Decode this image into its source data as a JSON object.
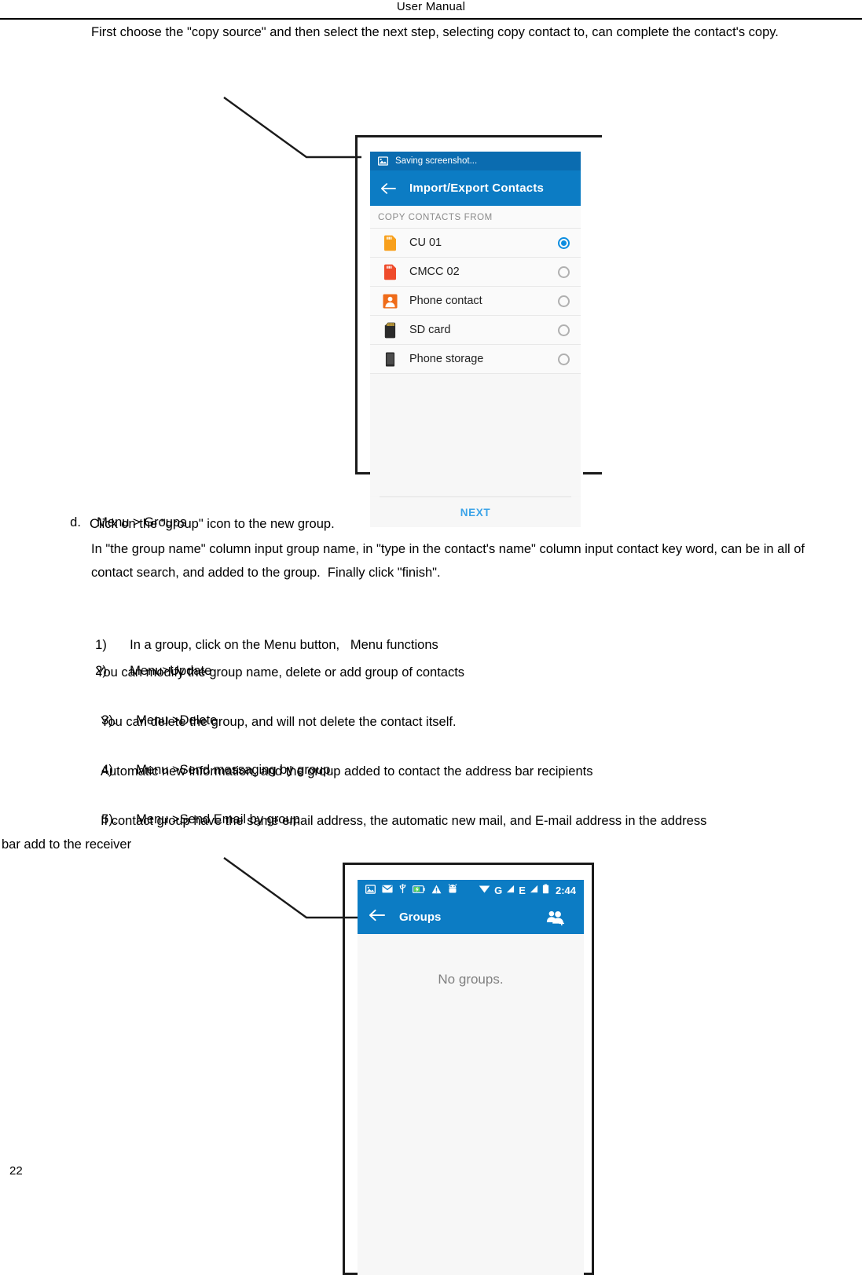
{
  "document": {
    "header_title": "User   Manual",
    "page_number": "22",
    "intro_paragraph": "First choose the \"copy source\" and then select the next step, selecting copy contact to, can complete the contact's copy.",
    "section_d": {
      "marker": "d.",
      "title": "Menu > Groups",
      "subtitle": "Click on the \"group\" icon to the new group.",
      "paragraph": "In \"the group name\" column input group name, in \"type in the contact's name\" column input contact key word, can be in all of contact search, and added to the group.  Finally click \"finish\"."
    },
    "numbered_list": [
      {
        "marker": "1)",
        "text": "In a group, click on the Menu button,   Menu functions"
      },
      {
        "marker": "2)",
        "text": "Menu>Update"
      }
    ],
    "line_update_desc": "You can modify the group name, delete or add group of contacts",
    "item3": {
      "marker": "3).",
      "text": "Menu >Delete"
    },
    "item3_desc": "You can delete the group, and will not delete the contact itself.",
    "item4": {
      "marker": "4).",
      "text": "Menu >Send messaging by group."
    },
    "item4_desc": "Automatic new information, and the group added to contact the address bar recipients",
    "item5": {
      "marker": "5).",
      "text": "Menu >Send Email by group"
    },
    "item5_desc_line1": "If contact group have the same email address, the automatic new mail, and E-mail address in the address",
    "item5_desc_line2": "bar add to the receiver"
  },
  "screenshot_import_export": {
    "notification": {
      "icon": "image-icon",
      "text": "Saving screenshot..."
    },
    "action_bar": {
      "back_icon": "back-arrow-icon",
      "title": "Import/Export Contacts"
    },
    "section_label": "COPY CONTACTS FROM",
    "rows": [
      {
        "label": "CU 01",
        "icon": "sim-card-orange-icon",
        "selected": true
      },
      {
        "label": "CMCC 02",
        "icon": "sim-card-red-icon",
        "selected": false
      },
      {
        "label": "Phone contact",
        "icon": "contact-person-icon",
        "selected": false
      },
      {
        "label": "SD card",
        "icon": "sd-card-icon",
        "selected": false
      },
      {
        "label": "Phone storage",
        "icon": "phone-storage-icon",
        "selected": false
      }
    ],
    "next_button": "NEXT",
    "colors": {
      "notification_bar": "#0b6cb0",
      "action_bar": "#0c7cc4",
      "accent": "#0c8de0",
      "next_text": "#3ba3e8"
    }
  },
  "screenshot_groups": {
    "status_bar": {
      "left_icons": [
        "image-icon",
        "email-icon",
        "usb-icon",
        "battery-charging-icon",
        "warning-triangle-icon",
        "android-icon"
      ],
      "wifi_icon": "wifi-icon",
      "signal_1_label": "G",
      "signal_2_label": "E",
      "battery_icon": "battery-icon",
      "time": "2:44"
    },
    "action_bar": {
      "back_icon": "back-arrow-icon",
      "title": "Groups",
      "add_group_icon": "add-group-icon"
    },
    "empty_state": "No groups.",
    "colors": {
      "action_bar": "#0c7cc4"
    }
  }
}
